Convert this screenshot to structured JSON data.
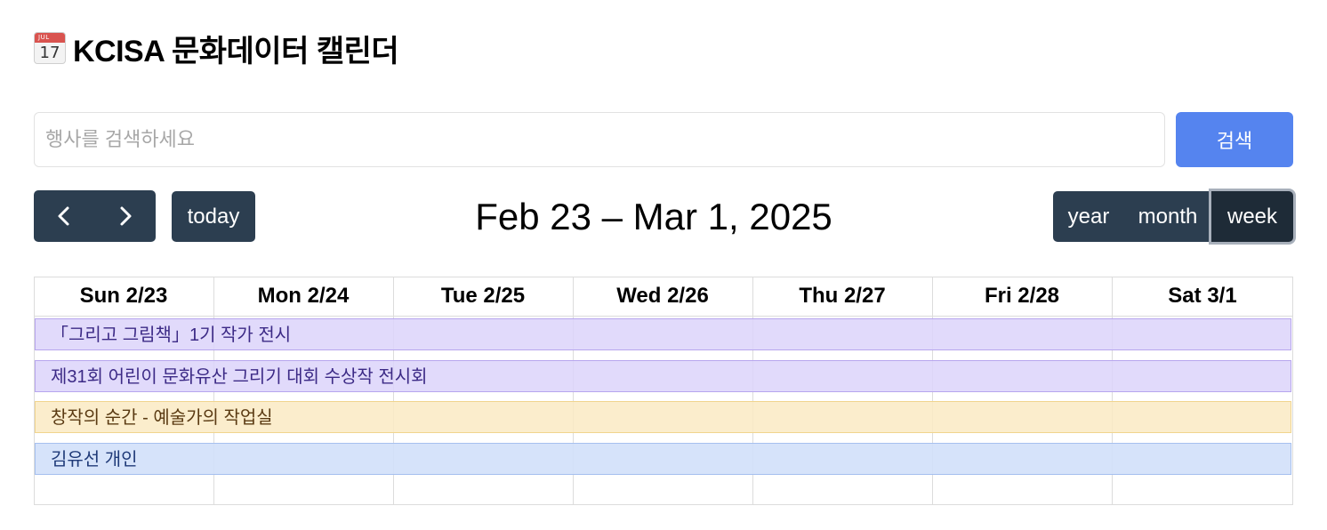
{
  "page": {
    "icon": {
      "name": "calendar-icon",
      "month": "JUL",
      "day": "17"
    },
    "title": "KCISA 문화데이터 캘린더"
  },
  "search": {
    "placeholder": "행사를 검색하세요",
    "value": "",
    "button_label": "검색"
  },
  "toolbar": {
    "prev_icon": "chevron-left-icon",
    "next_icon": "chevron-right-icon",
    "today_label": "today",
    "range_title": "Feb 23 – Mar 1, 2025",
    "views": [
      {
        "label": "year",
        "active": false
      },
      {
        "label": "month",
        "active": false
      },
      {
        "label": "week",
        "active": true
      }
    ]
  },
  "calendar": {
    "days": [
      "Sun 2/23",
      "Mon 2/24",
      "Tue 2/25",
      "Wed 2/26",
      "Thu 2/27",
      "Fri 2/28",
      "Sat 3/1"
    ],
    "events": [
      {
        "title": "「그리고 그림책」1기 작가 전시",
        "color": "purple"
      },
      {
        "title": "제31회 어린이 문화유산 그리기 대회 수상작 전시회",
        "color": "purple"
      },
      {
        "title": "창작의 순간 - 예술가의 작업실",
        "color": "orange"
      },
      {
        "title": "김유선 개인",
        "color": "blue"
      }
    ]
  },
  "colors": {
    "primary_button": "#5584ef",
    "toolbar_button": "#2c3e50",
    "event_purple": "#e3dcfb",
    "event_orange": "#fbecc8",
    "event_blue": "#d5e3fb"
  }
}
